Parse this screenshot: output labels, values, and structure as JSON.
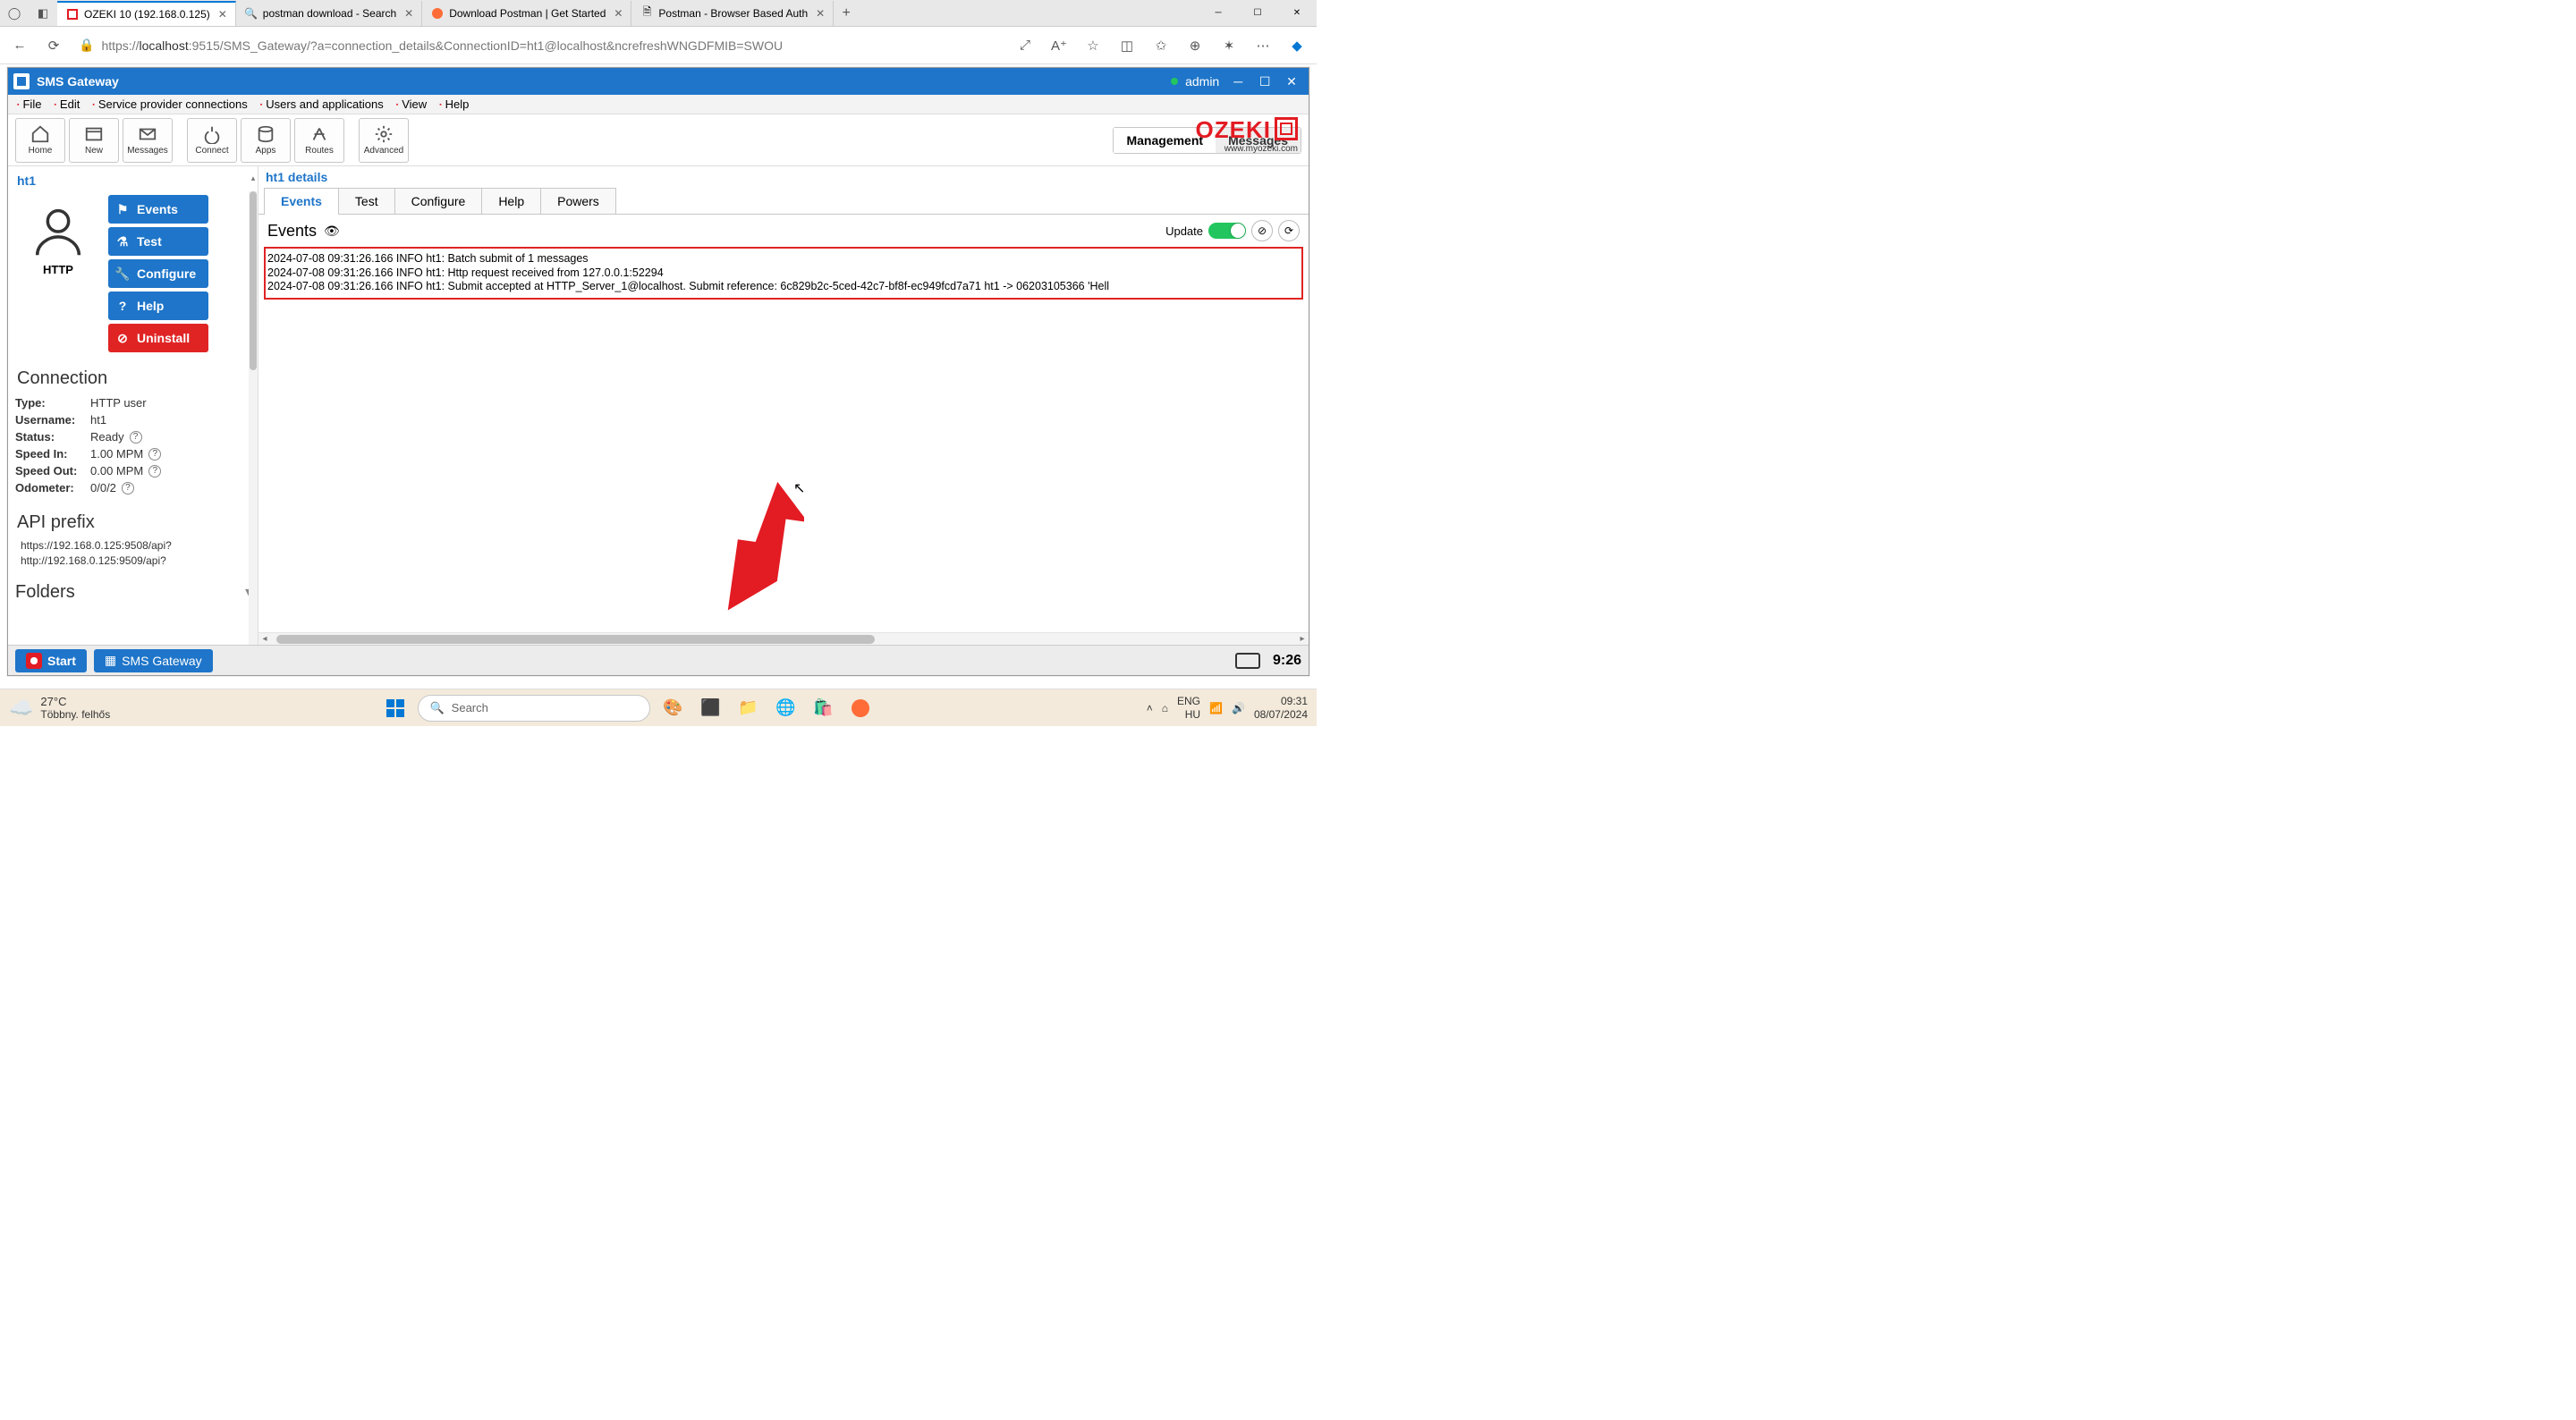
{
  "browser": {
    "tabs": [
      {
        "label": "OZEKI 10 (192.168.0.125)",
        "active": true,
        "fav": "ozeki"
      },
      {
        "label": "postman download - Search",
        "active": false,
        "fav": "bing"
      },
      {
        "label": "Download Postman | Get Started",
        "active": false,
        "fav": "postman"
      },
      {
        "label": "Postman - Browser Based Auth",
        "active": false,
        "fav": "page"
      }
    ],
    "url_prefix": "https://",
    "url_host": "localhost",
    "url_rest": ":9515/SMS_Gateway/?a=connection_details&ConnectionID=ht1@localhost&ncrefreshWNGDFMIB=SWOU"
  },
  "app": {
    "title": "SMS Gateway",
    "user": "admin",
    "menu": [
      "File",
      "Edit",
      "Service provider connections",
      "Users and applications",
      "View",
      "Help"
    ],
    "ozeki_url": "www.myozeki.com",
    "tools": [
      {
        "name": "home",
        "label": "Home"
      },
      {
        "name": "new",
        "label": "New"
      },
      {
        "name": "messages",
        "label": "Messages"
      },
      {
        "name": "connect",
        "label": "Connect"
      },
      {
        "name": "apps",
        "label": "Apps"
      },
      {
        "name": "routes",
        "label": "Routes"
      },
      {
        "name": "advanced",
        "label": "Advanced"
      }
    ],
    "right_tabs": {
      "management": "Management",
      "messages": "Messages",
      "active": "management"
    },
    "statusbar": {
      "start": "Start",
      "task": "SMS Gateway",
      "clock": "9:26"
    }
  },
  "sidebar": {
    "title": "ht1",
    "user_proto": "HTTP",
    "buttons": {
      "events": "Events",
      "test": "Test",
      "configure": "Configure",
      "help": "Help",
      "uninstall": "Uninstall"
    },
    "conn_h": "Connection",
    "conn": {
      "type_k": "Type:",
      "type_v": "HTTP user",
      "user_k": "Username:",
      "user_v": "ht1",
      "status_k": "Status:",
      "status_v": "Ready",
      "in_k": "Speed In:",
      "in_v": "1.00 MPM",
      "out_k": "Speed Out:",
      "out_v": "0.00 MPM",
      "odo_k": "Odometer:",
      "odo_v": "0/0/2"
    },
    "api_h": "API prefix",
    "api": [
      "https://192.168.0.125:9508/api?",
      "http://192.168.0.125:9509/api?"
    ],
    "folders_h": "Folders"
  },
  "main": {
    "title": "ht1 details",
    "subtabs": [
      "Events",
      "Test",
      "Configure",
      "Help",
      "Powers"
    ],
    "active_subtab": 0,
    "events_title": "Events",
    "update_label": "Update",
    "log": [
      "2024-07-08 09:31:26.166 INFO ht1: Batch submit of 1 messages",
      "2024-07-08 09:31:26.166 INFO ht1: Http request received from 127.0.0.1:52294",
      "2024-07-08 09:31:26.166 INFO ht1: Submit accepted at HTTP_Server_1@localhost. Submit reference: 6c829b2c-5ced-42c7-bf8f-ec949fcd7a71 ht1 -> 06203105366 'Hell"
    ]
  },
  "taskbar": {
    "temp": "27°C",
    "weather_text": "Többny. felhős",
    "search_placeholder": "Search",
    "lang1": "ENG",
    "lang2": "HU",
    "time": "09:31",
    "date": "08/07/2024"
  }
}
